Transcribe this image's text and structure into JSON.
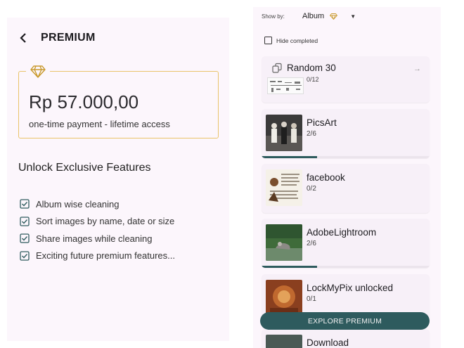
{
  "premium": {
    "title": "PREMIUM",
    "price": "Rp 57.000,00",
    "price_note": "one-time payment - lifetime access",
    "heading": "Unlock Exclusive Features",
    "features": [
      "Album wise cleaning",
      "Sort images by name, date or size",
      "Share images while cleaning",
      "Exciting future premium features..."
    ],
    "accent_color": "#e9c46a"
  },
  "albums": {
    "show_by_label": "Show by:",
    "selected": "Album",
    "hide_completed": "Hide completed",
    "hide_completed_checked": false,
    "items": [
      {
        "name": "Random 30",
        "count": "0/12",
        "progress": 0
      },
      {
        "name": "PicsArt",
        "count": "2/6",
        "progress": 0.33
      },
      {
        "name": "facebook",
        "count": "0/2",
        "progress": 0
      },
      {
        "name": "AdobeLightroom",
        "count": "2/6",
        "progress": 0.33
      },
      {
        "name": "LockMyPix unlocked",
        "count": "0/1",
        "progress": 0
      },
      {
        "name": "Download",
        "count": "",
        "progress": 0
      }
    ],
    "explore_label": "EXPLORE PREMIUM",
    "primary_color": "#2e5b5e"
  }
}
